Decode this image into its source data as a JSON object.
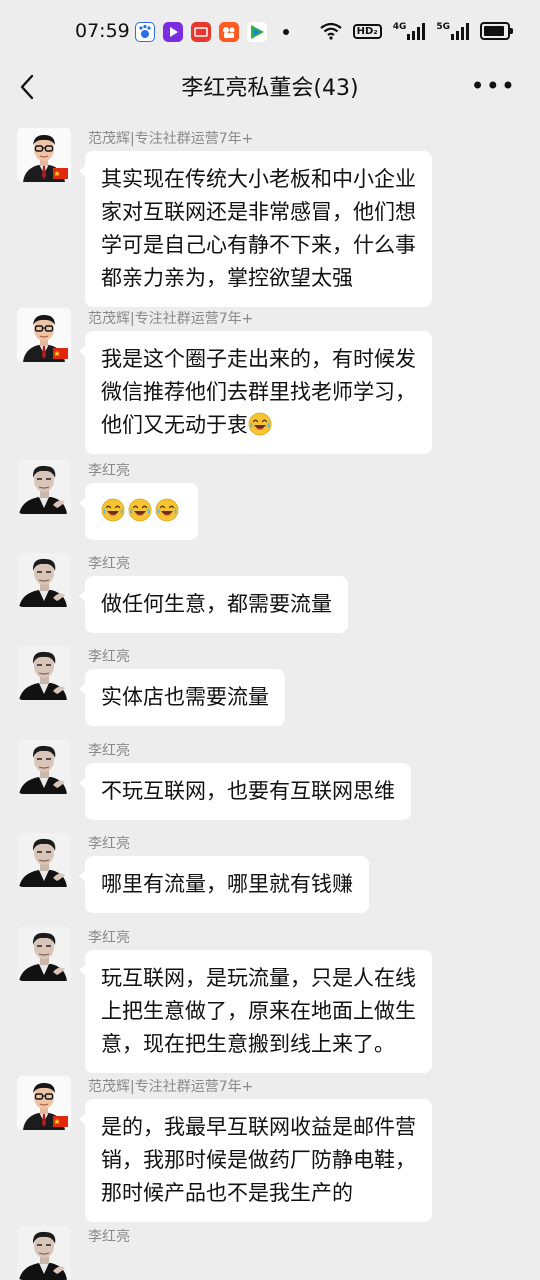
{
  "status_bar": {
    "time": "07:59",
    "hd_label": "HD₂",
    "net1": "4G",
    "net2": "5G"
  },
  "header": {
    "title": "李红亮私董会(43)"
  },
  "senders": {
    "fan": "范茂辉|专注社群运营7年+",
    "li": "李红亮"
  },
  "messages": [
    {
      "sender": "fan",
      "lines": [
        "其实现在传统大小老板和中小企业",
        "家对互联网还是非常感冒，他们想",
        "学可是自己心有静不下来，什么事",
        "都亲力亲为，掌控欲望太强"
      ]
    },
    {
      "sender": "fan",
      "lines": [
        "我是这个圈子走出来的，有时候发",
        "微信推荐他们去群里找老师学习，",
        "他们又无动于衷"
      ],
      "trailing_emoji": "laughing-crying-emoji"
    },
    {
      "sender": "li",
      "emojis": [
        "laughing-crying-emoji",
        "laughing-crying-emoji",
        "laughing-crying-emoji"
      ]
    },
    {
      "sender": "li",
      "lines": [
        "做任何生意，都需要流量"
      ]
    },
    {
      "sender": "li",
      "lines": [
        "实体店也需要流量"
      ]
    },
    {
      "sender": "li",
      "lines": [
        "不玩互联网，也要有互联网思维"
      ]
    },
    {
      "sender": "li",
      "lines": [
        "哪里有流量，哪里就有钱赚"
      ]
    },
    {
      "sender": "li",
      "lines": [
        "玩互联网，是玩流量，只是人在线",
        "上把生意做了，原来在地面上做生",
        "意，现在把生意搬到线上来了。"
      ]
    },
    {
      "sender": "fan",
      "lines": [
        "是的，我最早互联网收益是邮件营",
        "销，我那时候是做药厂防静电鞋，",
        "那时候产品也不是我生产的"
      ]
    },
    {
      "sender": "li",
      "lines": []
    }
  ]
}
